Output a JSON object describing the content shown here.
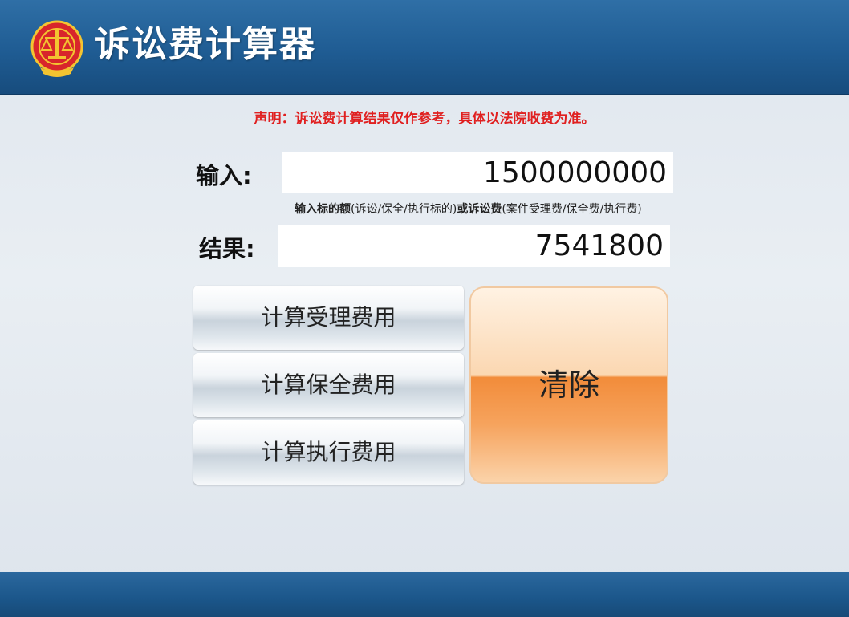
{
  "header": {
    "title": "诉讼费计算器",
    "emblem_icon": "court-emblem-icon"
  },
  "disclaimer": "声明：诉讼费计算结果仅作参考，具体以法院收费为准。",
  "input": {
    "label": "输入:",
    "value": "1500000000"
  },
  "hint": {
    "part1": "输入标的额",
    "part2": "(诉讼/保全/执行标的)",
    "part3": "或诉讼费",
    "part4": "(案件受理费/保全费/执行费)"
  },
  "result": {
    "label": "结果:",
    "value": "7541800"
  },
  "buttons": {
    "acceptance_fee": "计算受理费用",
    "preservation_fee": "计算保全费用",
    "execution_fee": "计算执行费用",
    "clear": "清除"
  },
  "colors": {
    "header_blue": "#1f5c93",
    "disclaimer_red": "#e02020",
    "clear_orange": "#f28c3a"
  }
}
